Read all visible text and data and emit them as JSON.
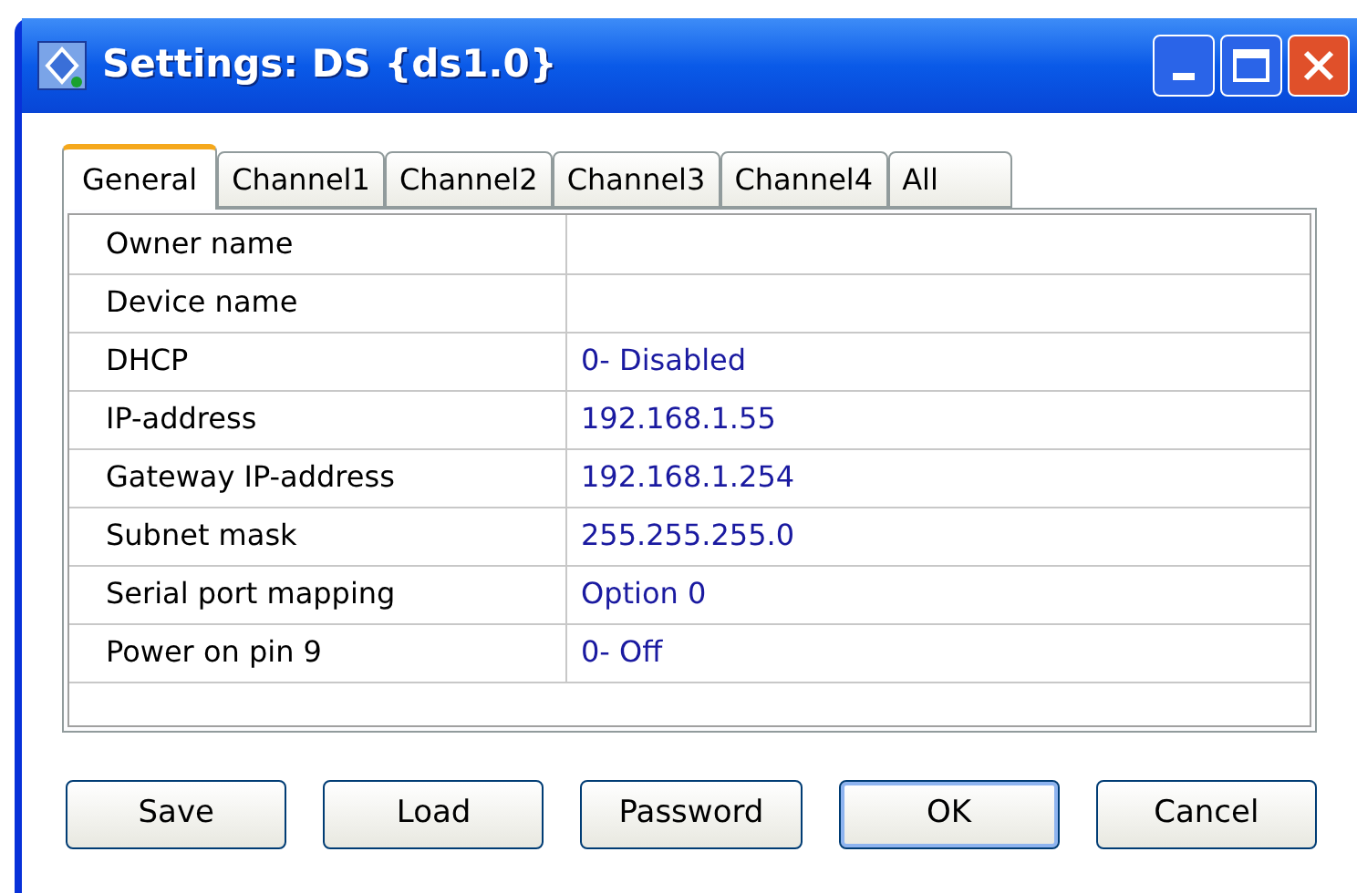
{
  "window": {
    "title": "Settings: DS {ds1.0}"
  },
  "tabs": [
    {
      "label": "General",
      "selected": true
    },
    {
      "label": "Channel1",
      "selected": false
    },
    {
      "label": "Channel2",
      "selected": false
    },
    {
      "label": "Channel3",
      "selected": false
    },
    {
      "label": "Channel4",
      "selected": false
    },
    {
      "label": "All",
      "selected": false
    }
  ],
  "properties": [
    {
      "name": "Owner name"
    },
    {
      "name": "Device name"
    },
    {
      "name": "DHCP",
      "value": "0- Disabled"
    },
    {
      "name": "IP-address",
      "value": "192.168.1.55"
    },
    {
      "name": "Gateway IP-address",
      "value": "192.168.1.254"
    },
    {
      "name": "Subnet mask",
      "value": "255.255.255.0"
    },
    {
      "name": "Serial port mapping",
      "value": "Option 0"
    },
    {
      "name": "Power on pin 9",
      "value": "0- Off"
    }
  ],
  "buttons": [
    {
      "label": "Save",
      "default": false
    },
    {
      "label": "Load",
      "default": false
    },
    {
      "label": "Password",
      "default": false
    },
    {
      "label": "OK",
      "default": true
    },
    {
      "label": "Cancel",
      "default": false
    }
  ]
}
